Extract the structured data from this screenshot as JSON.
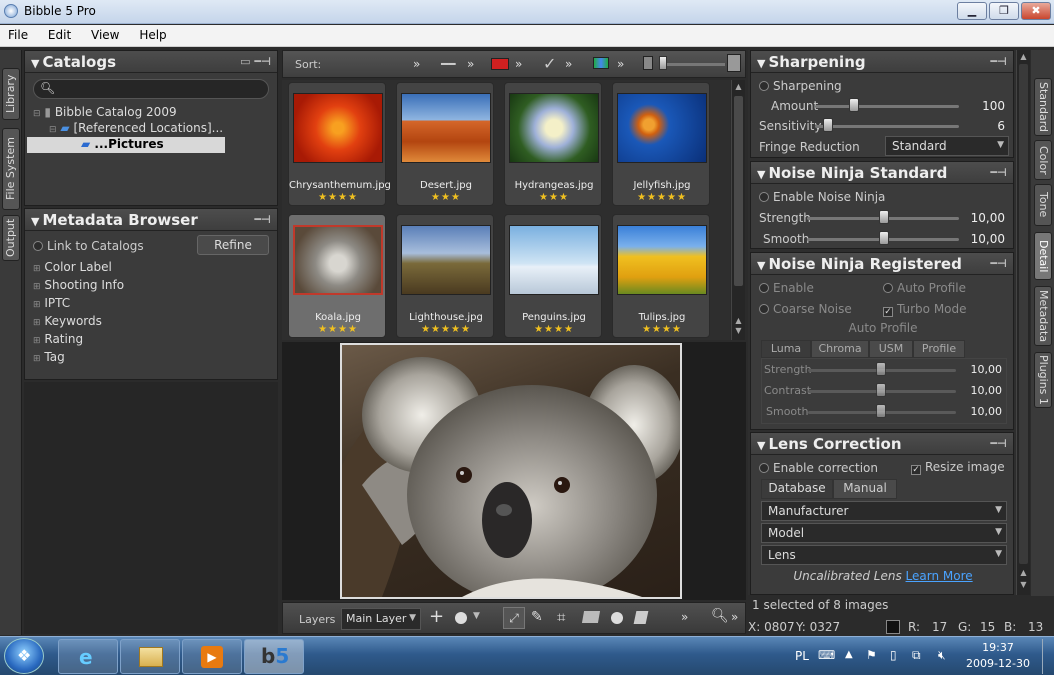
{
  "window": {
    "title": "Bibble 5 Pro",
    "minimize_label": "▁",
    "maximize_label": "❐",
    "close_label": "✖"
  },
  "menu": [
    "File",
    "Edit",
    "View",
    "Help"
  ],
  "left_tabs": [
    "Library",
    "File System",
    "Output"
  ],
  "catalogs": {
    "title": "Catalogs",
    "search_placeholder": "",
    "tree": [
      "Bibble Catalog 2009",
      "[Referenced Locations]...",
      "...Pictures"
    ]
  },
  "metadata_browser": {
    "title": "Metadata Browser",
    "link_label": "Link to Catalogs",
    "refine_label": "Refine",
    "items": [
      "Color Label",
      "Shooting Info",
      "IPTC",
      "Keywords",
      "Rating",
      "Tag"
    ]
  },
  "toolbar": {
    "sort_label": "Sort:"
  },
  "thumbnails": [
    {
      "name": "Chrysanthemum.jpg",
      "stars": "★★★★"
    },
    {
      "name": "Desert.jpg",
      "stars": "★★★"
    },
    {
      "name": "Hydrangeas.jpg",
      "stars": "★★★"
    },
    {
      "name": "Jellyfish.jpg",
      "stars": "★★★★★"
    },
    {
      "name": "Koala.jpg",
      "stars": "★★★★"
    },
    {
      "name": "Lighthouse.jpg",
      "stars": "★★★★★"
    },
    {
      "name": "Penguins.jpg",
      "stars": "★★★★"
    },
    {
      "name": "Tulips.jpg",
      "stars": "★★★★"
    }
  ],
  "bottom_toolbar": {
    "layers_label": "Layers",
    "layer_select": "Main Layer"
  },
  "status": {
    "selection": "1 selected of 8 images",
    "x": "X: 0807",
    "y": "Y: 0327",
    "r": "R:",
    "r_val": "17",
    "g": "G:",
    "g_val": "15",
    "b": "B:",
    "b_val": "13"
  },
  "sharpening": {
    "title": "Sharpening",
    "enable_label": "Sharpening",
    "amount_label": "Amount",
    "amount_value": "100",
    "sensitivity_label": "Sensitivity",
    "sensitivity_value": "6",
    "fringe_label": "Fringe Reduction",
    "fringe_value": "Standard"
  },
  "noise_standard": {
    "title": "Noise Ninja Standard",
    "enable_label": "Enable Noise Ninja",
    "strength_label": "Strength",
    "strength_value": "10,00",
    "smooth_label": "Smooth",
    "smooth_value": "10,00"
  },
  "noise_registered": {
    "title": "Noise Ninja Registered",
    "enable_label": "Enable",
    "auto_profile_label": "Auto Profile",
    "coarse_label": "Coarse Noise",
    "turbo_label": "Turbo Mode",
    "auto_profile_heading": "Auto Profile",
    "tabs": [
      "Luma",
      "Chroma",
      "USM",
      "Profile"
    ],
    "strength_label": "Strength",
    "strength_value": "10,00",
    "contrast_label": "Contrast",
    "contrast_value": "10,00",
    "smooth_label": "Smooth",
    "smooth_value": "10,00"
  },
  "lens_correction": {
    "title": "Lens Correction",
    "enable_label": "Enable correction",
    "resize_label": "Resize image",
    "tabs": [
      "Database",
      "Manual"
    ],
    "manufacturer": "Manufacturer",
    "model": "Model",
    "lens": "Lens",
    "uncalibrated": "Uncalibrated Lens",
    "learn_more": "Learn More"
  },
  "right_tabs": [
    "Standard",
    "Color",
    "Tone",
    "Detail",
    "Metadata",
    "Plugins 1"
  ],
  "taskbar": {
    "lang": "PL",
    "time": "19:37",
    "date": "2009-12-30"
  },
  "colors": {
    "accent_link": "#4aa3ff",
    "star": "#f0c020",
    "panel": "#3b3b3b"
  }
}
